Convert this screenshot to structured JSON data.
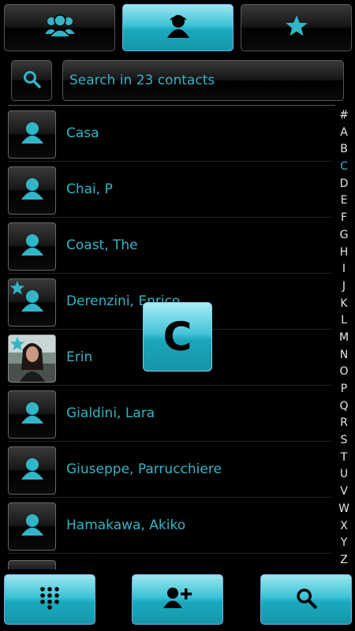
{
  "tabs": [
    {
      "name": "groups",
      "icon": "groups-icon"
    },
    {
      "name": "contacts",
      "icon": "person-icon"
    },
    {
      "name": "favorites",
      "icon": "star-icon"
    }
  ],
  "search": {
    "placeholder": "Search in 23 contacts",
    "value": ""
  },
  "contacts": [
    {
      "name": "Casa",
      "photo": false,
      "favorite": false
    },
    {
      "name": "Chai, P",
      "photo": false,
      "favorite": false
    },
    {
      "name": "Coast, The",
      "photo": false,
      "favorite": false
    },
    {
      "name": "Derenzini, Enrico",
      "photo": false,
      "favorite": true
    },
    {
      "name": "Erin",
      "photo": true,
      "favorite": true
    },
    {
      "name": "Gialdini, Lara",
      "photo": false,
      "favorite": false
    },
    {
      "name": "Giuseppe, Parrucchiere",
      "photo": false,
      "favorite": false
    },
    {
      "name": "Hamakawa, Akiko",
      "photo": false,
      "favorite": false
    }
  ],
  "index_letters": [
    "#",
    "A",
    "B",
    "C",
    "D",
    "E",
    "F",
    "G",
    "H",
    "I",
    "J",
    "K",
    "L",
    "M",
    "N",
    "O",
    "P",
    "Q",
    "R",
    "S",
    "T",
    "U",
    "V",
    "W",
    "X",
    "Y",
    "Z"
  ],
  "active_letter": "C",
  "popup_letter": "C",
  "bottom_actions": [
    {
      "name": "dialpad",
      "icon": "dialpad-icon"
    },
    {
      "name": "add-contact",
      "icon": "add-person-icon"
    },
    {
      "name": "search",
      "icon": "search-icon"
    }
  ],
  "colors": {
    "accent": "#33b5c8",
    "background": "#000000",
    "index_text": "#e6e6e6"
  }
}
